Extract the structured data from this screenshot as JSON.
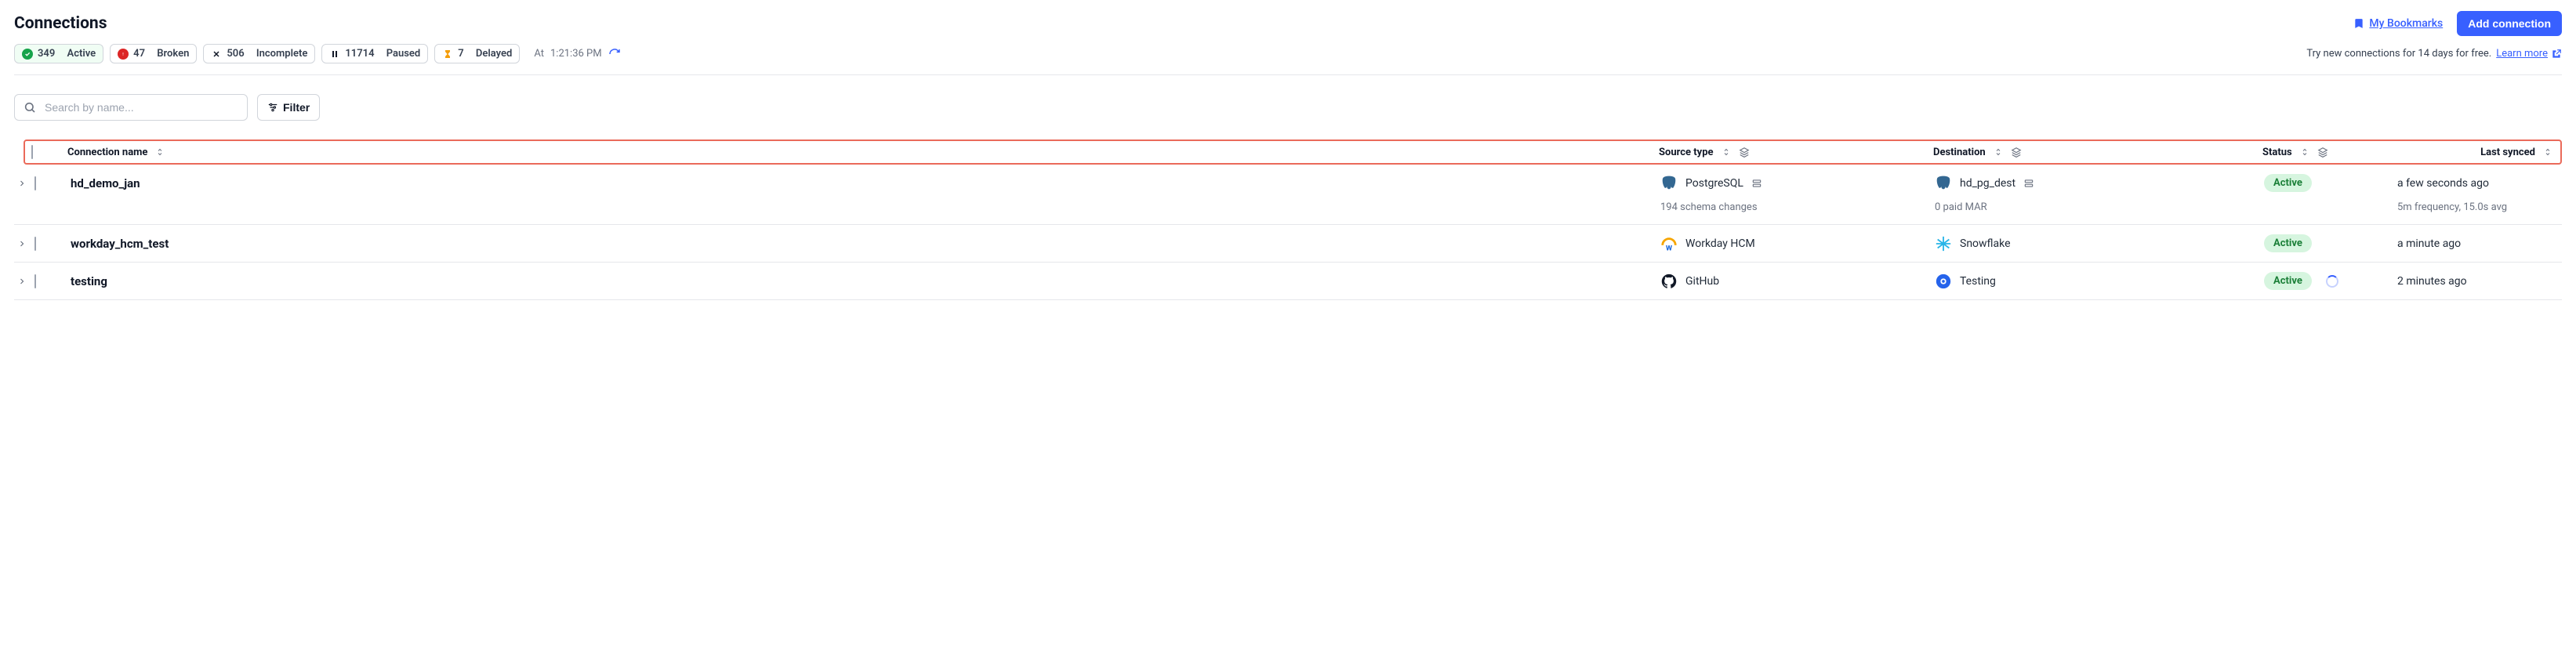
{
  "header": {
    "title": "Connections",
    "bookmarks_label": "My Bookmarks",
    "add_button": "Add connection"
  },
  "status_pills": {
    "active": {
      "count": "349",
      "label": "Active"
    },
    "broken": {
      "count": "47",
      "label": "Broken"
    },
    "incomplete": {
      "count": "506",
      "label": "Incomplete"
    },
    "paused": {
      "count": "11714",
      "label": "Paused"
    },
    "delayed": {
      "count": "7",
      "label": "Delayed"
    }
  },
  "timestamp": {
    "prefix": "At",
    "time": "1:21:36 PM"
  },
  "trial": {
    "text": "Try new connections for 14 days for free.",
    "learn_more": "Learn more"
  },
  "tools": {
    "search_placeholder": "Search by name...",
    "filter_label": "Filter"
  },
  "columns": {
    "name": "Connection name",
    "source": "Source type",
    "destination": "Destination",
    "status": "Status",
    "last_synced": "Last synced"
  },
  "rows": [
    {
      "name": "hd_demo_jan",
      "source": {
        "icon": "postgres",
        "label": "PostgreSQL"
      },
      "destination": {
        "icon": "postgres",
        "label": "hd_pg_dest"
      },
      "status": "Active",
      "last_synced": "a few seconds ago",
      "source_sub": "194 schema changes",
      "dest_sub": "0 paid MAR",
      "sync_sub": "5m frequency, 15.0s avg",
      "spinner": false,
      "show_sub": true,
      "source_extra_icon": true,
      "dest_extra_icon": true
    },
    {
      "name": "workday_hcm_test",
      "source": {
        "icon": "workday",
        "label": "Workday HCM"
      },
      "destination": {
        "icon": "snowflake",
        "label": "Snowflake"
      },
      "status": "Active",
      "last_synced": "a minute ago",
      "spinner": false,
      "show_sub": false,
      "source_extra_icon": false,
      "dest_extra_icon": false
    },
    {
      "name": "testing",
      "source": {
        "icon": "github",
        "label": "GitHub"
      },
      "destination": {
        "icon": "testing",
        "label": "Testing"
      },
      "status": "Active",
      "last_synced": "2 minutes ago",
      "spinner": true,
      "show_sub": false,
      "source_extra_icon": false,
      "dest_extra_icon": false
    }
  ]
}
